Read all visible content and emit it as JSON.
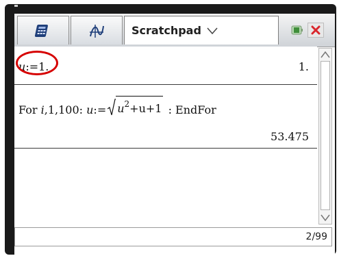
{
  "tabs": [
    {
      "name": "calculator",
      "icon": "calculator-icon"
    },
    {
      "name": "graphs",
      "icon": "graph-icon"
    },
    {
      "name": "scratchpad",
      "label": "Scratchpad",
      "icon": "chevron-down-icon"
    }
  ],
  "window": {
    "battery_icon": "battery-icon",
    "close_icon": "close-icon"
  },
  "history": [
    {
      "input_var": "u",
      "input_assign": ":=",
      "input_value": "1.",
      "result": "1."
    },
    {
      "loop_prefix": "For",
      "loop_var": "i",
      "loop_args": ",1,100:",
      "assign_var": "u",
      "assign_op": ":=",
      "radicand_var": "u",
      "exponent": "2",
      "plus_u": "+u",
      "plus_one": "+1",
      "suffix": ": EndFor",
      "result": "53.475"
    }
  ],
  "status": {
    "page": "2/99"
  },
  "colors": {
    "highlight": "#d60000",
    "bezel": "#1a1a1a"
  }
}
